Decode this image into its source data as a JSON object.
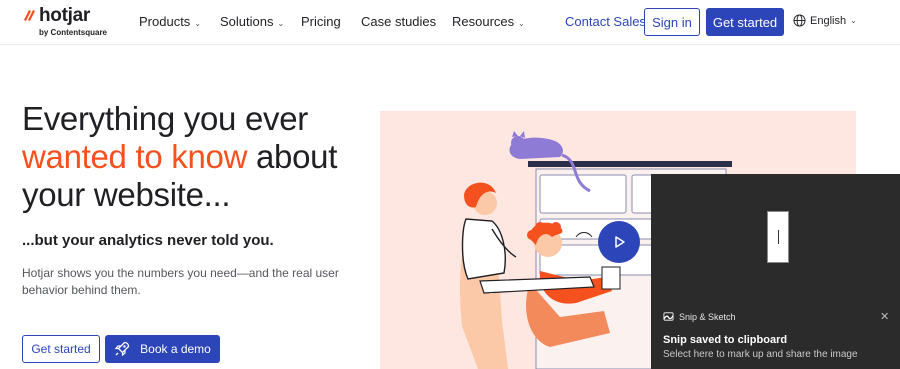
{
  "brand": {
    "name": "hotjar",
    "sub": "by Contentsquare",
    "accent_color": "#f4511e",
    "primary_color": "#2c45b8"
  },
  "nav": {
    "items": [
      {
        "label": "Products",
        "has_dropdown": true
      },
      {
        "label": "Solutions",
        "has_dropdown": true
      },
      {
        "label": "Pricing",
        "has_dropdown": false
      },
      {
        "label": "Case studies",
        "has_dropdown": false
      },
      {
        "label": "Resources",
        "has_dropdown": true
      }
    ],
    "contact_sales": "Contact Sales",
    "sign_in": "Sign in",
    "get_started": "Get started",
    "language": "English"
  },
  "hero": {
    "headline_line1": "Everything you ever",
    "headline_accent": "wanted to know",
    "headline_after_accent": "about",
    "headline_line3": "your website...",
    "subhead": "...but your analytics never told you.",
    "body": "Hotjar shows you the numbers you need—and the real user behavior behind them.",
    "cta_primary": "Get started",
    "cta_demo": "Book a demo"
  },
  "toast": {
    "app_name": "Snip & Sketch",
    "title": "Snip saved to clipboard",
    "message": "Select here to mark up and share the image",
    "close_icon": "close-icon"
  },
  "icons": {
    "play": "play-icon",
    "rocket": "rocket-icon",
    "globe": "globe-icon"
  }
}
